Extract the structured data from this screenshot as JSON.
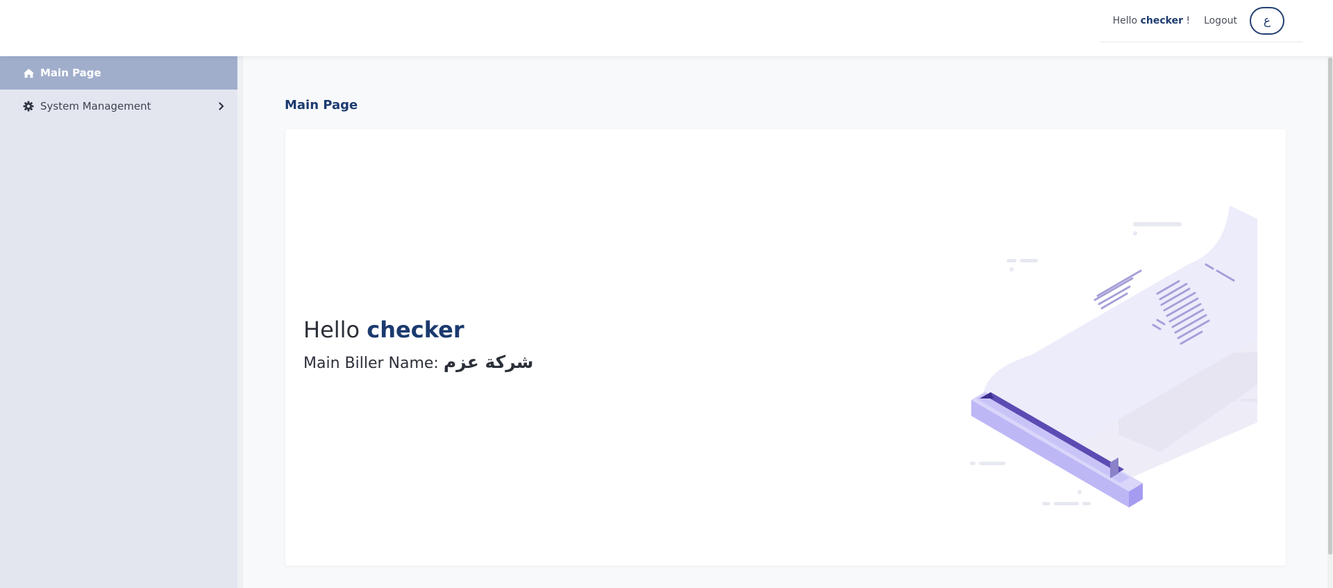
{
  "topbar": {
    "greeting_prefix": "Hello",
    "username": "checker",
    "greeting_suffix": "!",
    "logout_label": "Logout",
    "language_label": "ع"
  },
  "sidebar": {
    "items": [
      {
        "label": "Main Page",
        "icon": "home-icon",
        "active": true
      },
      {
        "label": "System Management",
        "icon": "gear-icon",
        "expandable": true
      }
    ]
  },
  "main": {
    "page_title": "Main Page",
    "hello_prefix": "Hello",
    "username": "checker",
    "biller_label": "Main Biller Name:",
    "biller_name": "شركة عزم",
    "illustration": "receipt-printer-illustration"
  },
  "colors": {
    "brand": "#1b3a6e",
    "sidebar_bg": "#e3e6ef",
    "sidebar_active": "#a0aecb",
    "illustration_purple": "#5b4bb3"
  }
}
